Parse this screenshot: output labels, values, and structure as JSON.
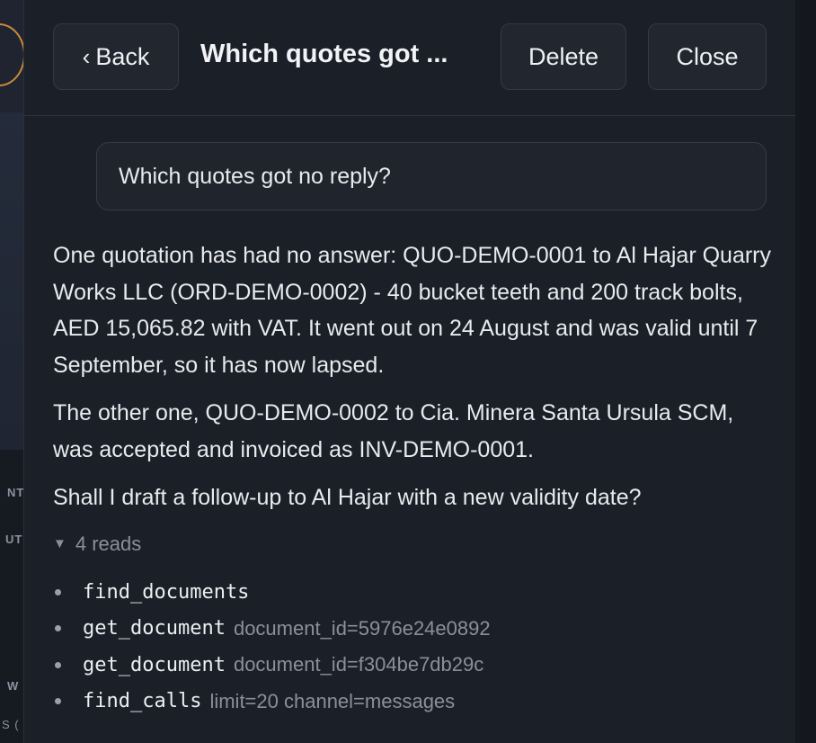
{
  "background": {
    "fragments": [
      "NT",
      "UT",
      "W",
      "S ("
    ]
  },
  "header": {
    "back_label": "Back",
    "title": "Which quotes got ...",
    "delete_label": "Delete",
    "close_label": "Close"
  },
  "conversation": {
    "question": "Which quotes got no reply?",
    "answer_paragraphs": [
      "One quotation has had no answer: QUO-DEMO-0001 to Al Hajar Quarry Works LLC (ORD-DEMO-0002) - 40 bucket teeth and 200 track bolts, AED 15,065.82 with VAT. It went out on 24 August and was valid until 7 September, so it has now lapsed.",
      "The other one, QUO-DEMO-0002 to Cia. Minera Santa Ursula SCM, was accepted and invoiced as INV-DEMO-0001.",
      "Shall I draft a follow-up to Al Hajar with a new validity date?"
    ],
    "reads_label": "4 reads",
    "tool_calls": [
      {
        "name": "find_documents",
        "args": ""
      },
      {
        "name": "get_document",
        "args": "document_id=5976e24e0892"
      },
      {
        "name": "get_document",
        "args": "document_id=f304be7db29c"
      },
      {
        "name": "find_calls",
        "args": "limit=20 channel=messages"
      }
    ]
  },
  "colors": {
    "panel_bg": "#1b1f27",
    "text": "#e8eaee",
    "muted": "#8a909b",
    "avatar_ring": "#c98a3a"
  }
}
